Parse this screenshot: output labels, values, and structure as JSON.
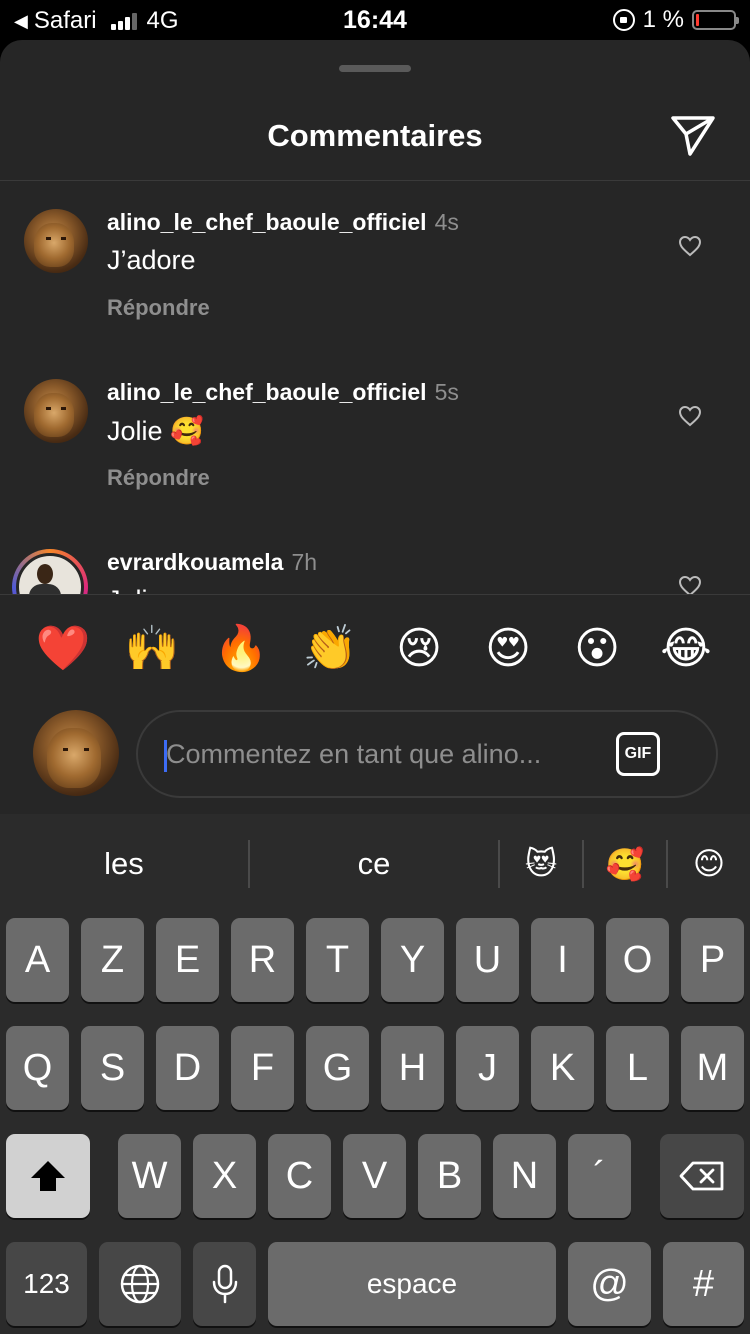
{
  "status_bar": {
    "back_label": "Safari",
    "network": "4G",
    "time": "16:44",
    "battery": "1 %",
    "battery_color": "#ff3b30"
  },
  "sheet": {
    "title": "Commentaires",
    "send_icon": "paper-plane-icon"
  },
  "comments": [
    {
      "user": "alino_le_chef_baoule_officiel",
      "time": "4s",
      "text": "J’adore",
      "reply": "Répondre"
    },
    {
      "user": "alino_le_chef_baoule_officiel",
      "time": "5s",
      "text": "Jolie 🥰",
      "reply": "Répondre"
    },
    {
      "user": "evrardkouamela",
      "time": "7h",
      "text": "Jolie"
    }
  ],
  "reactions": [
    "❤️",
    "🙌",
    "🔥",
    "👏",
    "😢",
    "😍",
    "😮",
    "😂"
  ],
  "composer": {
    "placeholder": "Commentez en tant que alino...",
    "gif_label": "GIF"
  },
  "keyboard": {
    "suggestions": [
      "les",
      "ce",
      "😻",
      "🥰",
      "😊"
    ],
    "row1": [
      "A",
      "Z",
      "E",
      "R",
      "T",
      "Y",
      "U",
      "I",
      "O",
      "P"
    ],
    "row2": [
      "Q",
      "S",
      "D",
      "F",
      "G",
      "H",
      "J",
      "K",
      "L",
      "M"
    ],
    "row3": [
      "W",
      "X",
      "C",
      "V",
      "B",
      "N",
      "´"
    ],
    "numbers_label": "123",
    "space_label": "espace",
    "at_label": "@",
    "hash_label": "#"
  }
}
